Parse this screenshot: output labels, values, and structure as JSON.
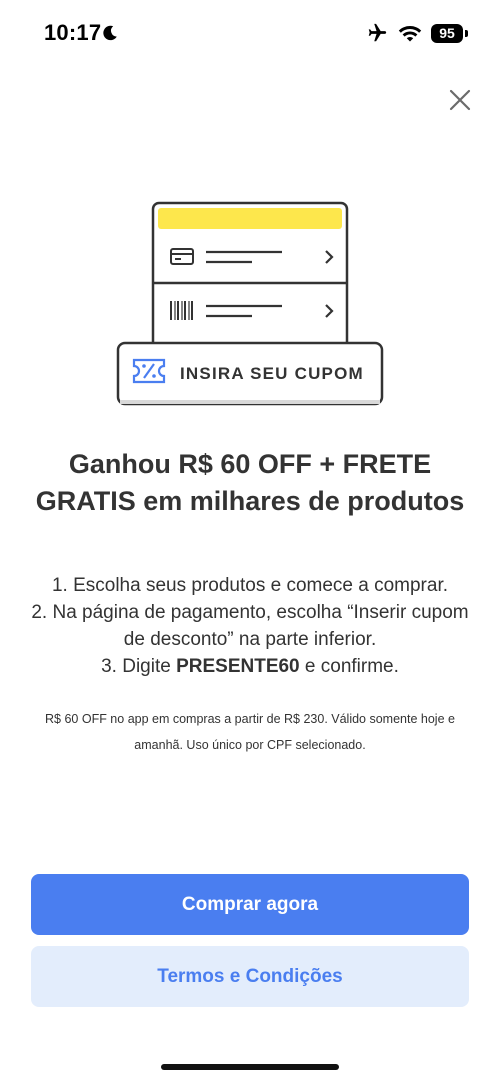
{
  "status_bar": {
    "time": "10:17",
    "battery": "95",
    "icons": [
      "moon-icon",
      "airplane-icon",
      "wifi-icon",
      "battery-icon"
    ]
  },
  "close_icon": "close-icon",
  "illustration": {
    "coupon_label": "INSIRA SEU CUPOM",
    "accent_color": "#fde74c",
    "icons": [
      "credit-card-icon",
      "barcode-icon",
      "chevron-right-icon",
      "coupon-ticket-icon"
    ]
  },
  "headline": "Ganhou R$ 60 OFF + FRETE GRATIS em milhares de produtos",
  "steps": {
    "step1": "1. Escolha seus produtos e comece a comprar.",
    "step2": "2. Na página de pagamento, escolha “Inserir cupom de desconto” na parte inferior.",
    "step3_prefix": "3. Digite ",
    "step3_code": "PRESENTE60",
    "step3_suffix": " e confirme."
  },
  "fine_print": "R$ 60 OFF no app em compras a partir de R$ 230. Válido somente hoje e amanhã. Uso único por CPF selecionado.",
  "buttons": {
    "primary_label": "Comprar agora",
    "secondary_label": "Termos e Condições"
  },
  "colors": {
    "primary": "#4a7ef0",
    "secondary_bg": "#e3edfc",
    "text": "#333333"
  }
}
